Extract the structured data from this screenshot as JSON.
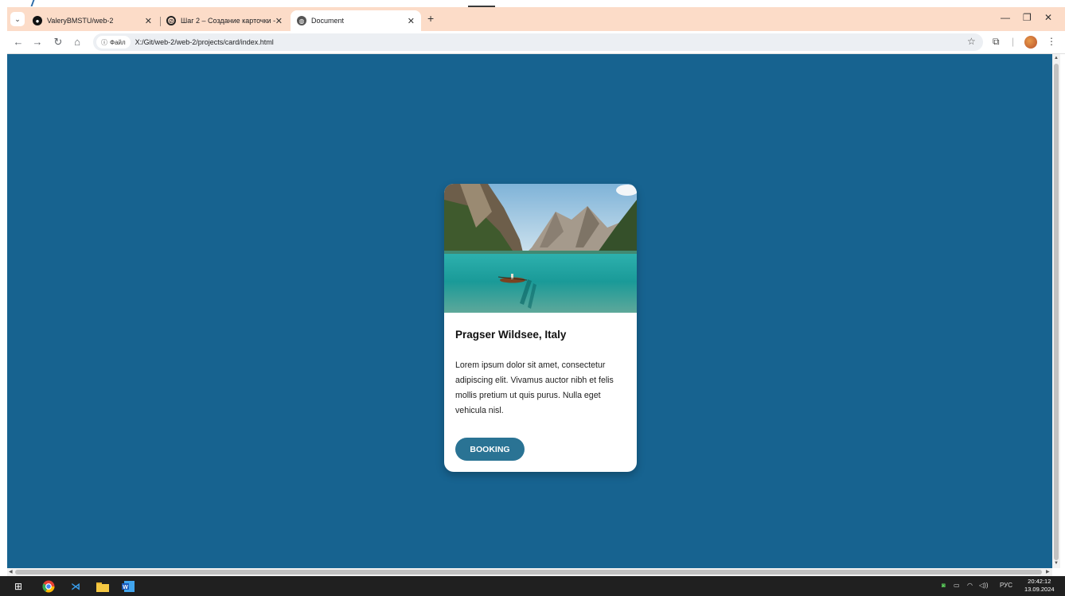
{
  "browser": {
    "tabs": [
      {
        "title": "ValeryBMSTU/web-2",
        "icon": "github-icon"
      },
      {
        "title": "Шаг 2 – Создание карточки - ",
        "icon": "practicum-icon"
      },
      {
        "title": "Document",
        "icon": "globe-icon",
        "active": true
      }
    ],
    "new_tab_label": "+",
    "address": {
      "chip_label": "Файл",
      "url": "X:/Git/web-2/web-2/projects/card/index.html"
    }
  },
  "page": {
    "background_color": "#176390",
    "card": {
      "title": "Pragser Wildsee, Italy",
      "description": "Lorem ipsum dolor sit amet, consectetur adipiscing elit. Vivamus auctor nibh et felis mollis pretium ut quis purus. Nulla eget vehicula nisl.",
      "button_label": "BOOKING",
      "button_color": "#2a7394"
    }
  },
  "taskbar": {
    "language": "РУС",
    "time": "20:42:12",
    "date": "13.09.2024"
  }
}
